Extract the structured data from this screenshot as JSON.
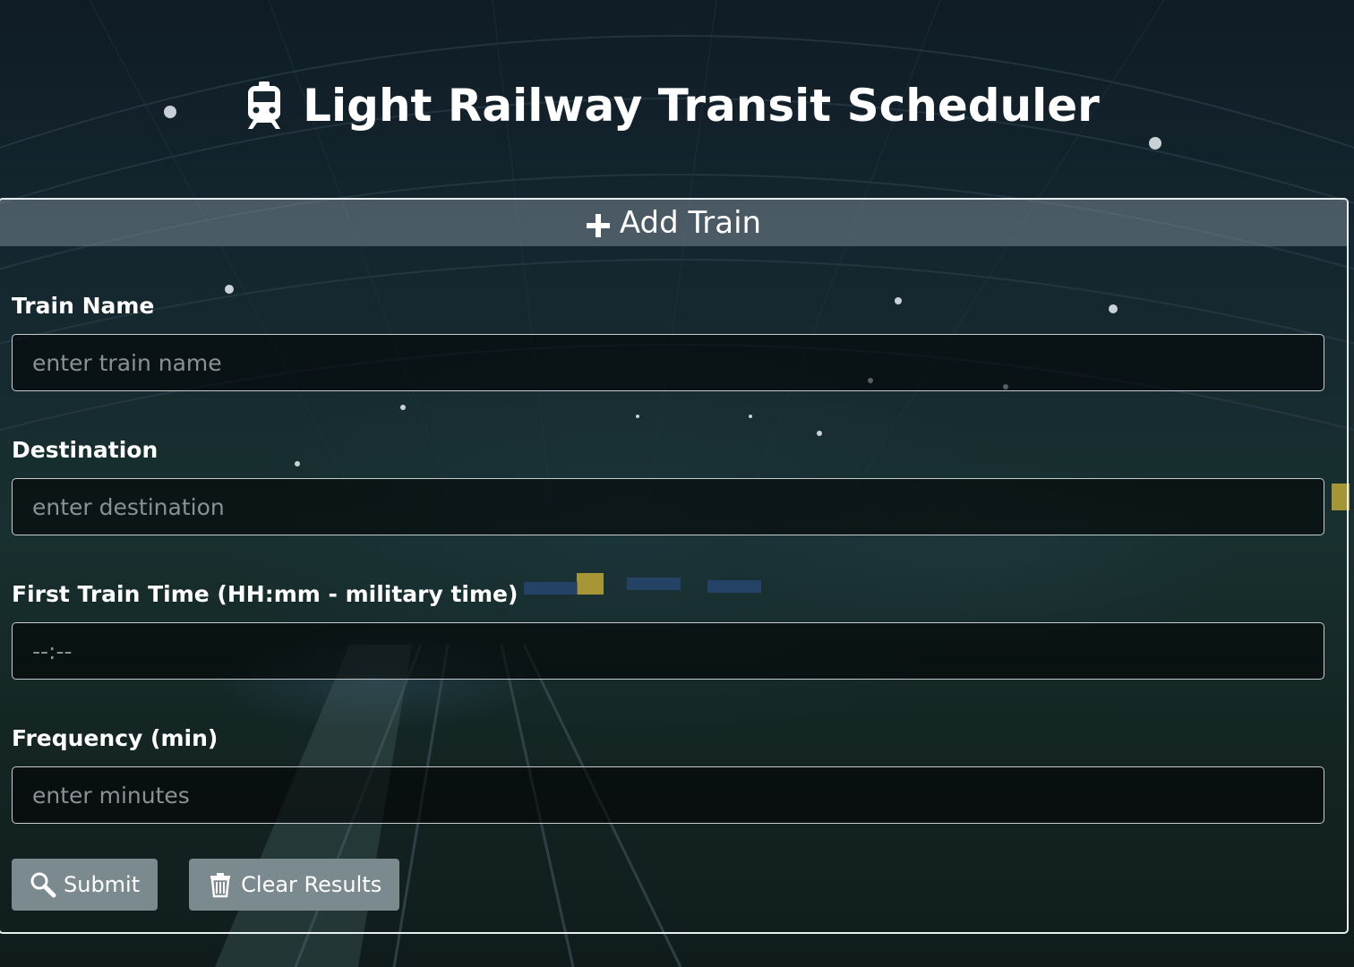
{
  "header": {
    "title": "Light Railway Transit Scheduler",
    "icon": "train-icon"
  },
  "panel": {
    "title": "Add Train",
    "icon": "plus-icon"
  },
  "form": {
    "train_name": {
      "label": "Train Name",
      "placeholder": "enter train name",
      "value": ""
    },
    "destination": {
      "label": "Destination",
      "placeholder": "enter destination",
      "value": ""
    },
    "first_train_time": {
      "label": "First Train Time (HH:mm - military time)",
      "placeholder": "--:--",
      "value": ""
    },
    "frequency": {
      "label": "Frequency (min)",
      "placeholder": "enter minutes",
      "value": ""
    }
  },
  "buttons": {
    "submit": {
      "label": "Submit",
      "icon": "search-icon"
    },
    "clear": {
      "label": "Clear Results",
      "icon": "trash-icon"
    }
  },
  "colors": {
    "button_bg": "#7b8a8f",
    "panel_header_bg": "#78878f",
    "border": "#e9eef0"
  }
}
